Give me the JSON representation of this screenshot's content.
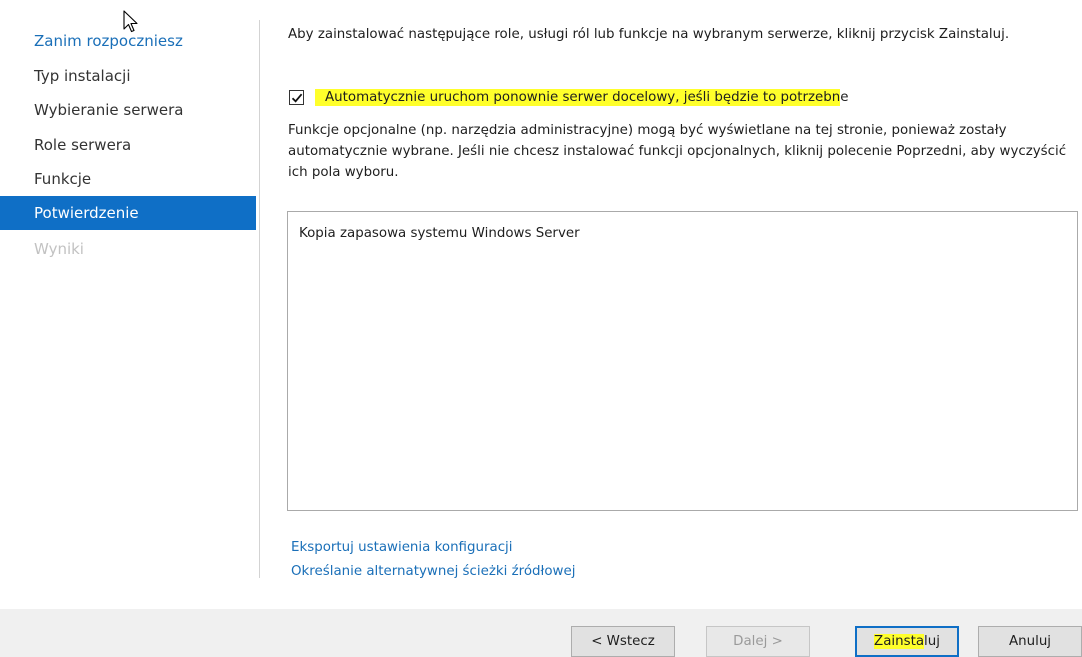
{
  "sidebar": {
    "items": [
      {
        "label": "Zanim rozpoczniesz",
        "state": "link"
      },
      {
        "label": "Typ instalacji",
        "state": "normal"
      },
      {
        "label": "Wybieranie serwera",
        "state": "normal"
      },
      {
        "label": "Role serwera",
        "state": "normal"
      },
      {
        "label": "Funkcje",
        "state": "normal"
      },
      {
        "label": "Potwierdzenie",
        "state": "active"
      },
      {
        "label": "Wyniki",
        "state": "disabled"
      }
    ]
  },
  "main": {
    "intro_text": "Aby zainstalować następujące role, usługi ról lub funkcje na wybranym serwerze, kliknij przycisk Zainstaluj.",
    "restart_checkbox": {
      "checked": true,
      "label_highlighted": "Automatycznie uruchom ponownie serwer docelowy, jeśli będzie to potrzebn",
      "label_tail": "e"
    },
    "optional_text": "Funkcje opcjonalne (np. narzędzia administracyjne) mogą być wyświetlane na tej stronie, ponieważ zostały automatycznie wybrane. Jeśli nie chcesz instalować funkcji opcjonalnych, kliknij polecenie Poprzedni, aby wyczyścić ich pola wyboru.",
    "features": [
      "Kopia zapasowa systemu Windows Server"
    ],
    "links": {
      "export": "Eksportuj ustawienia konfiguracji",
      "alt_source": "Określanie alternatywnej ścieżki źródłowej"
    }
  },
  "footer": {
    "back_label": "< Wstecz",
    "next_label": "Dalej >",
    "install_label_hl": "Zainsta",
    "install_label_tail": "luj",
    "cancel_label": "Anuluj"
  },
  "colors": {
    "accent": "#0f6fc6",
    "link": "#1a6fb8",
    "highlight": "#ffff2b"
  }
}
